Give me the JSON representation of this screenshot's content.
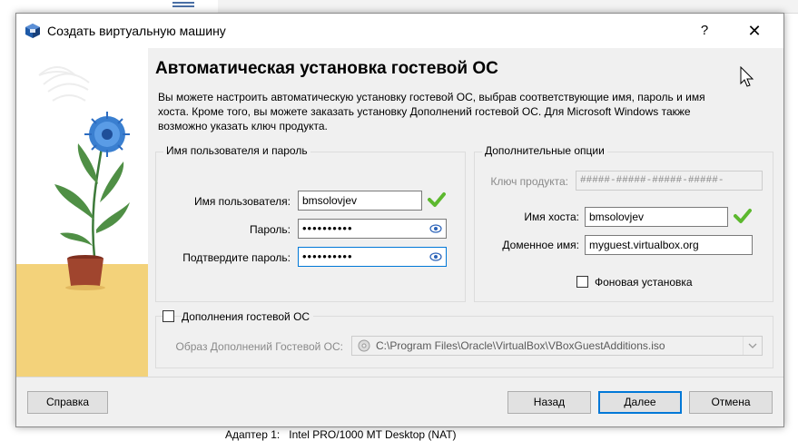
{
  "background": {
    "bottom_text": "Адаптер 1:   Intel PRO/1000 MT Desktop (NAT)"
  },
  "window": {
    "title": "Создать виртуальную машину",
    "help_glyph": "?",
    "close_glyph": "✕"
  },
  "page": {
    "heading": "Автоматическая установка гостевой ОС",
    "description": "Вы можете настроить автоматическую установку гостевой ОС, выбрав соответствующие имя, пароль и имя хоста. Кроме того, вы можете заказать установку Дополнений гостевой ОС. Для Microsoft Windows также возможно указать ключ продукта."
  },
  "user_group": {
    "title": "Имя пользователя и пароль",
    "username_label": "Имя пользователя:",
    "username_value": "bmsolovjev",
    "password_label": "Пароль:",
    "password_value": "••••••••••",
    "confirm_label": "Подтвердите пароль:",
    "confirm_value": "••••••••••"
  },
  "options_group": {
    "title": "Дополнительные опции",
    "product_key_label": "Ключ продукта:",
    "product_key_placeholder": "#####-#####-#####-#####-",
    "hostname_label": "Имя хоста:",
    "hostname_value": "bmsolovjev",
    "domain_label": "Доменное имя:",
    "domain_value": "myguest.virtualbox.org",
    "unattended_label": "Фоновая установка"
  },
  "additions_group": {
    "checkbox_label": "Дополнения гостевой ОС",
    "iso_label": "Образ Дополнений Гостевой ОС:",
    "iso_value": "C:\\Program Files\\Oracle\\VirtualBox\\VBoxGuestAdditions.iso"
  },
  "buttons": {
    "help": "Справка",
    "back": "Назад",
    "next": "Далее",
    "cancel": "Отмена"
  },
  "colors": {
    "accent": "#0078d7",
    "check": "#5cb82e",
    "flower": "#3a7fd0",
    "pot": "#a0452e",
    "table": "#f3d27a"
  }
}
